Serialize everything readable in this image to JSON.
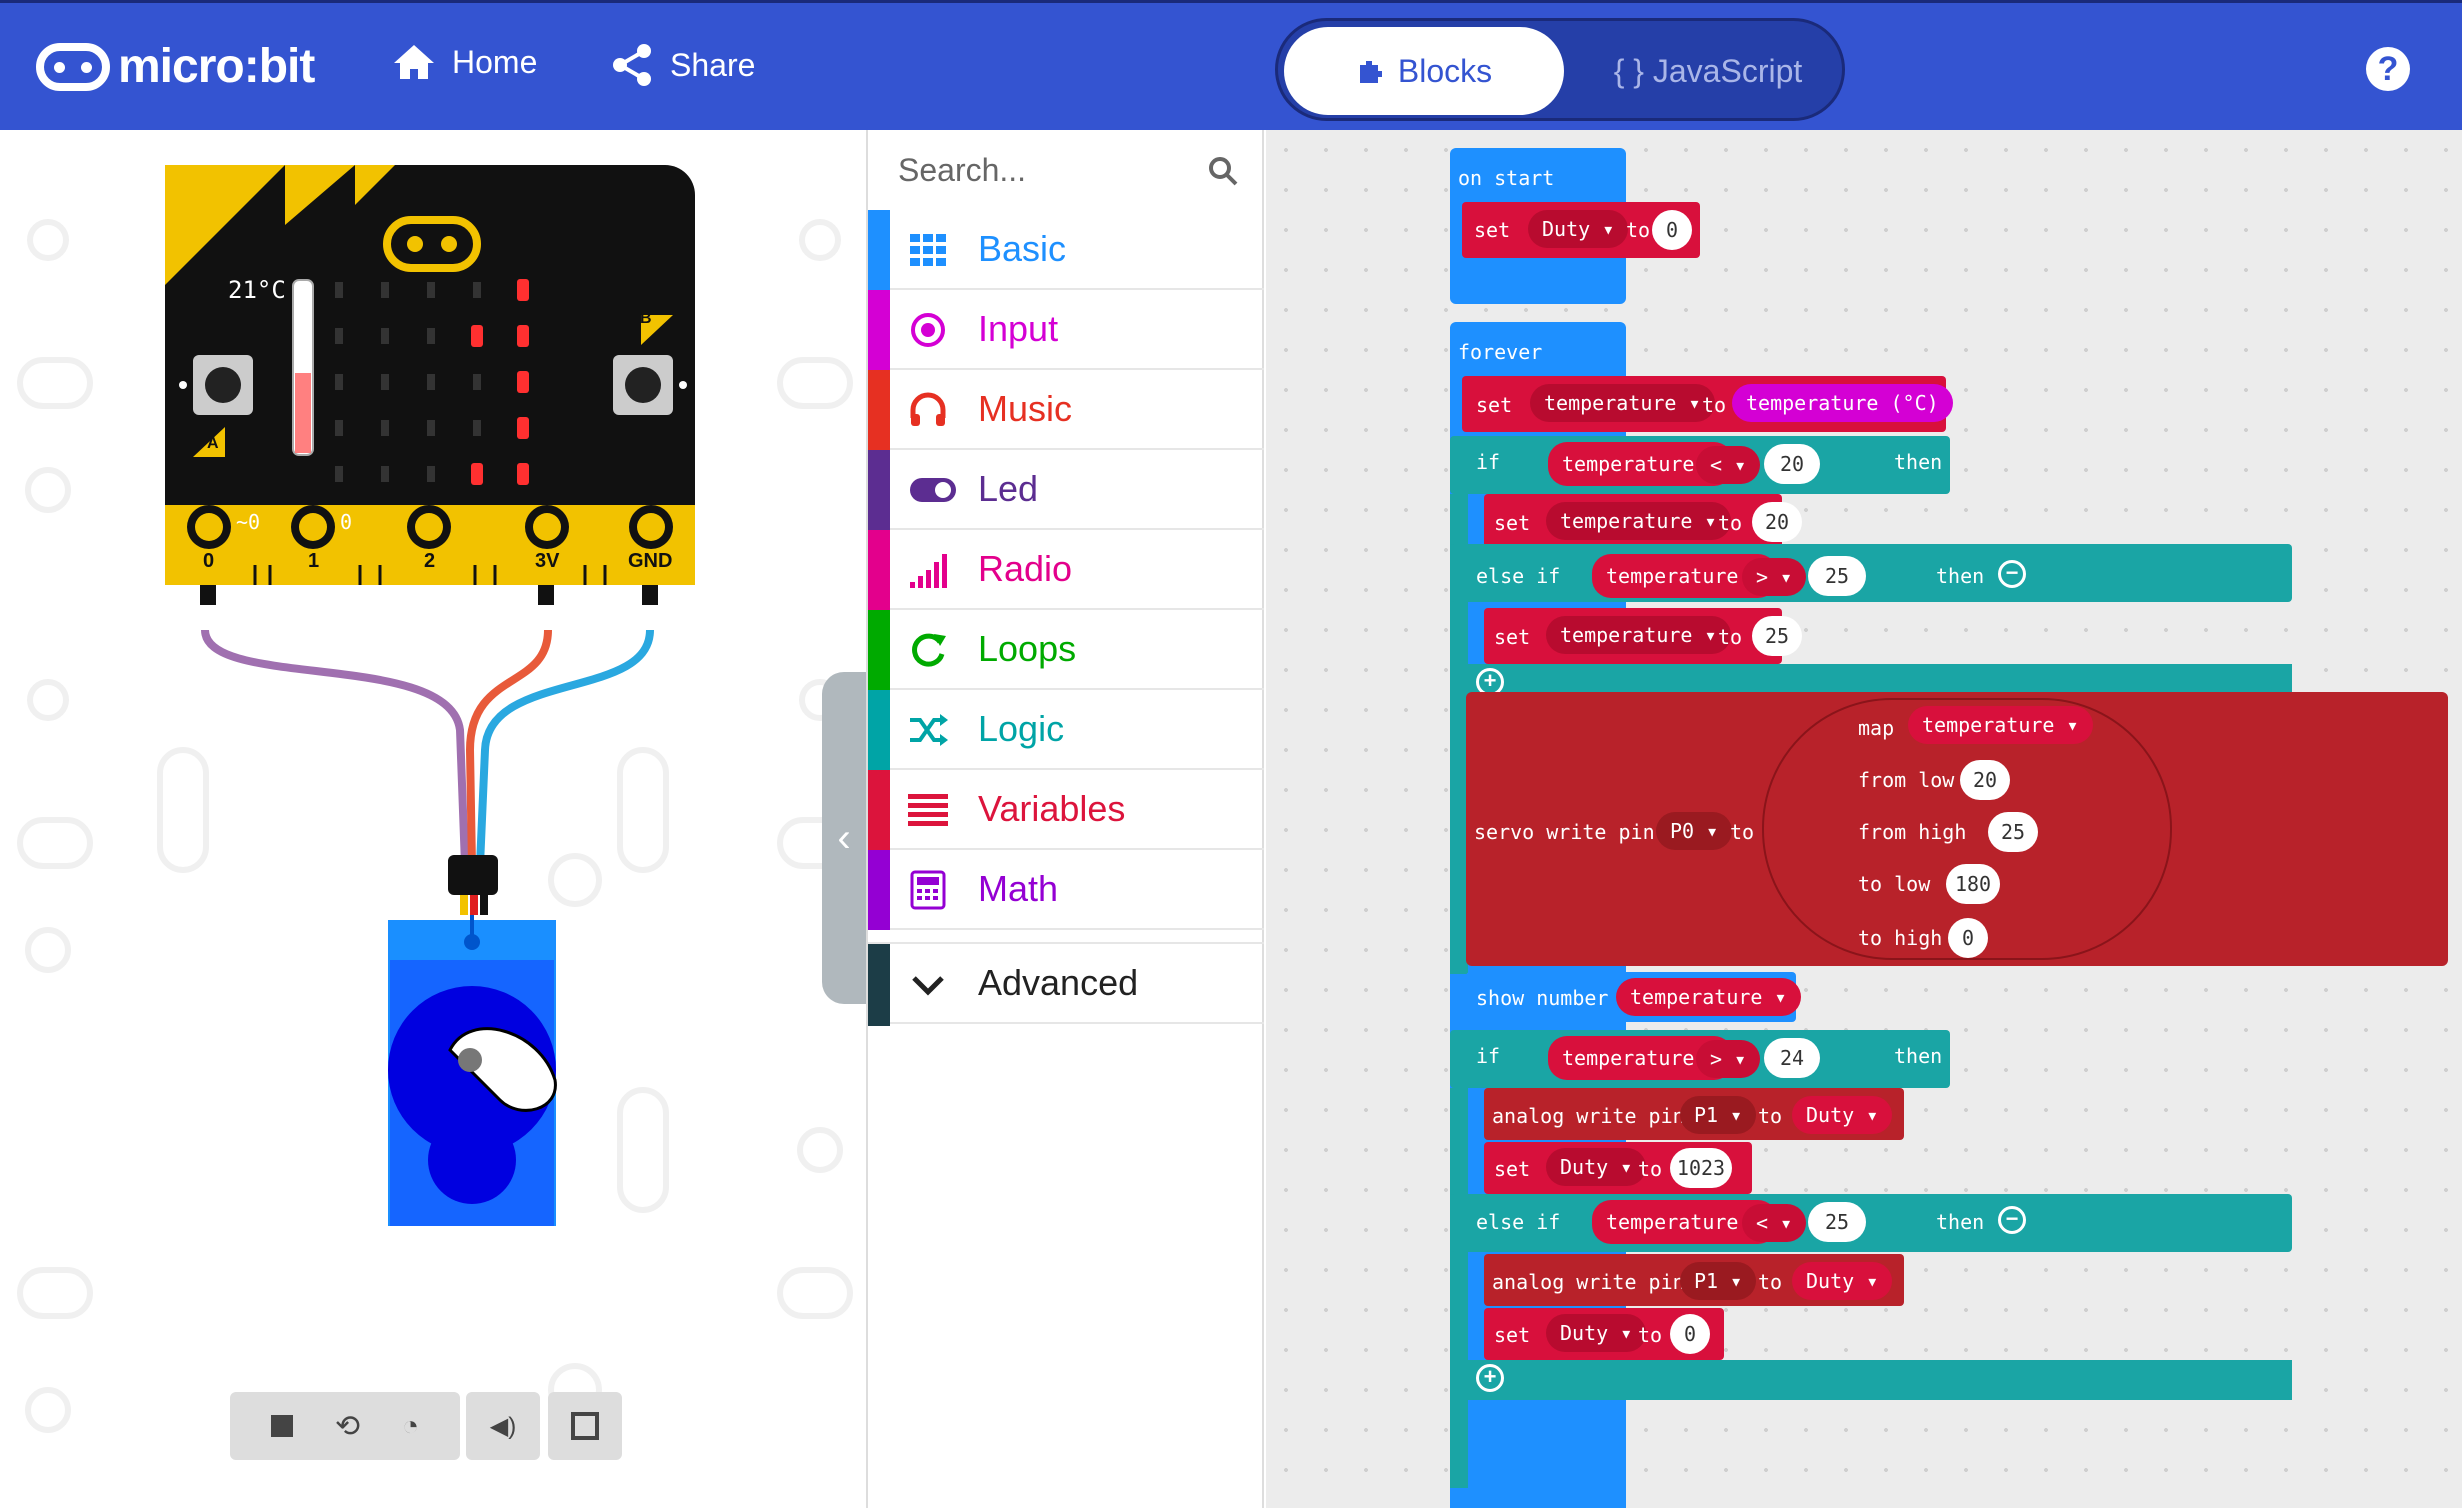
{
  "header": {
    "logo": "micro:bit",
    "home_label": "Home",
    "share_label": "Share",
    "blocks_label": "Blocks",
    "js_label": "{ } JavaScript",
    "help": "?"
  },
  "simulator": {
    "temp": "21°C",
    "pin_labels": [
      "0",
      "1",
      "2",
      "3V",
      "GND"
    ],
    "pin_values": [
      "~0",
      "0"
    ],
    "button_a": "A",
    "button_b": "B"
  },
  "toolbox": {
    "search_placeholder": "Search...",
    "categories": [
      {
        "label": "Basic",
        "color": "#1e90ff"
      },
      {
        "label": "Input",
        "color": "#d400d4"
      },
      {
        "label": "Music",
        "color": "#e63022"
      },
      {
        "label": "Led",
        "color": "#5c2d91"
      },
      {
        "label": "Radio",
        "color": "#e3008c"
      },
      {
        "label": "Loops",
        "color": "#00aa00"
      },
      {
        "label": "Logic",
        "color": "#00a4a6"
      },
      {
        "label": "Variables",
        "color": "#dc143c"
      },
      {
        "label": "Math",
        "color": "#9400d3"
      }
    ],
    "advanced": "Advanced"
  },
  "code": {
    "on_start": "on start",
    "forever": "forever",
    "set": "set",
    "to": "to",
    "if": "if",
    "then": "then",
    "else_if": "else if",
    "duty": "Duty ▾",
    "temperature": "temperature ▾",
    "temperature_c": "temperature (°C)",
    "lt": "< ▾",
    "gt": "> ▾",
    "n0": "0",
    "n20": "20",
    "n25": "25",
    "n24": "24",
    "n180": "180",
    "n1023": "1023",
    "servo": "servo write pin",
    "p0": "P0 ▾",
    "p1": "P1 ▾",
    "map": "map",
    "from_low": "from low",
    "from_high": "from high",
    "to_low": "to low",
    "to_high": "to high",
    "show_number": "show number",
    "analog_write": "analog write pin"
  }
}
